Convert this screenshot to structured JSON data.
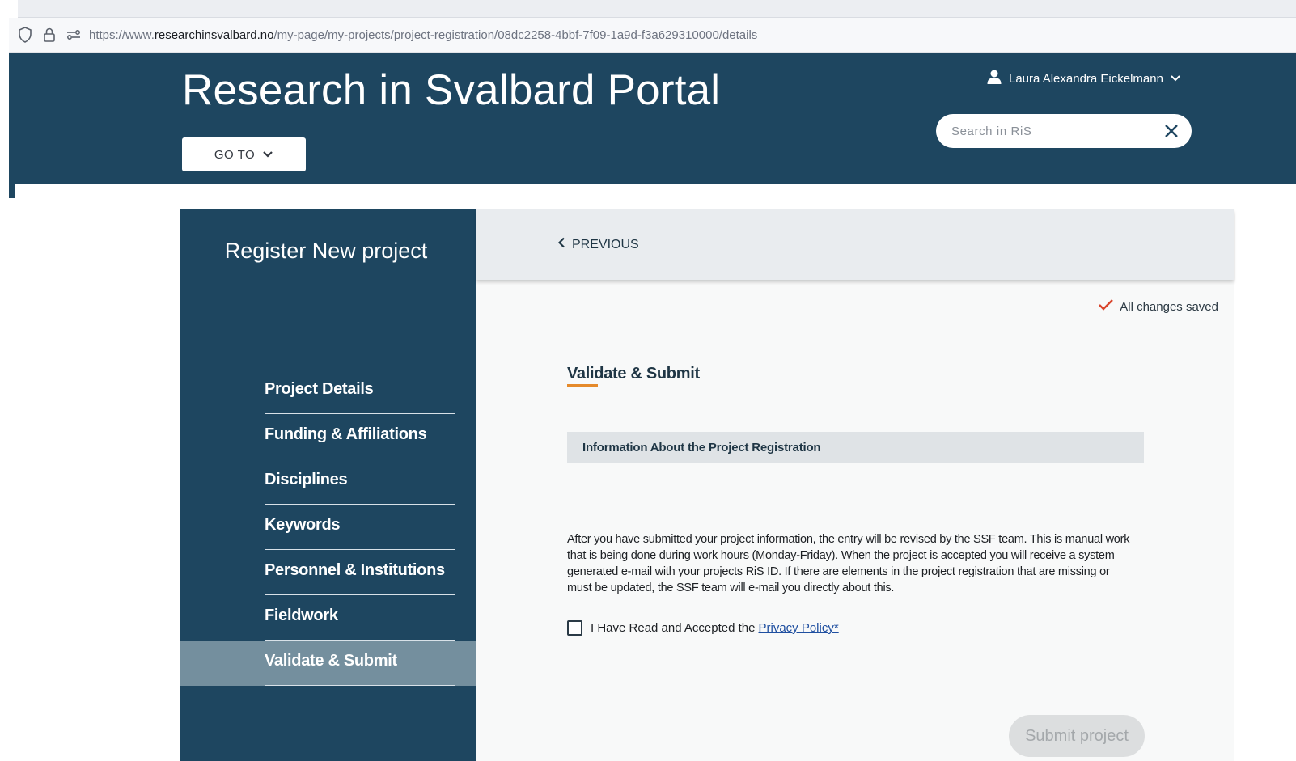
{
  "browser": {
    "url_prefix": "https://www.",
    "url_domain": "researchinsvalbard.no",
    "url_path": "/my-page/my-projects/project-registration/08dc2258-4bbf-7f09-1a9d-f3a629310000/details"
  },
  "header": {
    "title": "Research in Svalbard Portal",
    "goto_label": "GO TO",
    "user_name": "Laura Alexandra Eickelmann",
    "search_placeholder": "Search in RiS"
  },
  "sidebar": {
    "title": "Register New project",
    "items": [
      {
        "label": "Project Details",
        "active": false
      },
      {
        "label": "Funding & Affiliations",
        "active": false
      },
      {
        "label": "Disciplines",
        "active": false
      },
      {
        "label": "Keywords",
        "active": false
      },
      {
        "label": "Personnel & Institutions",
        "active": false
      },
      {
        "label": "Fieldwork",
        "active": false
      },
      {
        "label": "Validate & Submit",
        "active": true
      }
    ]
  },
  "main": {
    "previous_label": "PREVIOUS",
    "saved_status": "All changes saved",
    "section_title": "Validate & Submit",
    "info_heading": "Information About the Project Registration",
    "info_text": "After you have submitted your project information, the entry will be revised by the SSF team. This is manual work that is being done during work hours (Monday-Friday). When the project is accepted you will receive a system generated e-mail with your projects RiS ID. If there are elements in the project registration that are missing or must be updated, the SSF team will e-mail you directly about this.",
    "consent_text": "I Have Read and Accepted the",
    "privacy_link": "Privacy Policy*",
    "submit_label": "Submit project"
  },
  "colors": {
    "header_bg": "#1e4660",
    "active_nav": "#748f9e",
    "accent_underline": "#e58a2b",
    "check_red": "#d9442b",
    "link_blue": "#1f4fa0"
  }
}
